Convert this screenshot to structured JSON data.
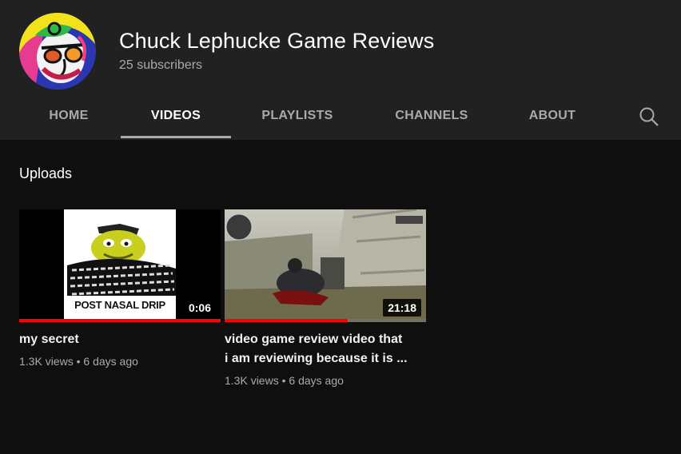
{
  "channel": {
    "name": "Chuck Lephucke Game Reviews",
    "subscribers": "25 subscribers"
  },
  "tabs": [
    {
      "label": "HOME",
      "active": false
    },
    {
      "label": "VIDEOS",
      "active": true
    },
    {
      "label": "PLAYLISTS",
      "active": false
    },
    {
      "label": "CHANNELS",
      "active": false
    },
    {
      "label": "ABOUT",
      "active": false
    }
  ],
  "search": {
    "icon": "search-icon"
  },
  "section": {
    "title": "Uploads"
  },
  "videos": [
    {
      "title": "my secret",
      "duration": "0:06",
      "views": "1.3K views",
      "age": "6 days ago",
      "thumbnail_caption": "POST NASAL DRIP",
      "watched_fraction": 1.0
    },
    {
      "title": "video game review video that i am reviewing because it is ...",
      "duration": "21:18",
      "views": "1.3K views",
      "age": "6 days ago",
      "watched_fraction": 0.61
    }
  ],
  "colors": {
    "header_bg": "#212121",
    "page_bg": "#0f0f0f",
    "progress": "#ff0000",
    "muted_text": "#aaaaaa"
  }
}
